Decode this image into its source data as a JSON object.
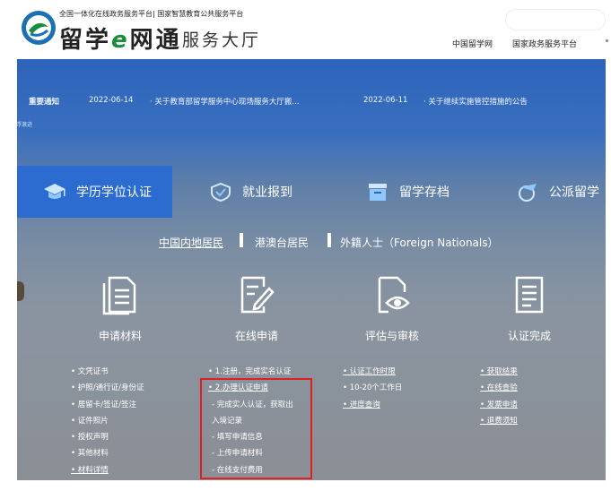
{
  "header": {
    "tagline": "全国一体化在线政务服务平台| 国家智慧教育公共服务平台",
    "logo_title_1": "留学",
    "logo_title_e": "e",
    "logo_title_2": "网通",
    "logo_subtitle": "服务大厅",
    "nav": [
      "中国留学网",
      "国家政务服务平台"
    ]
  },
  "notice": {
    "label": "重要通知",
    "items": [
      {
        "date": "2022-06-14",
        "text": "· 关于教育部留学服务中心现场服务大厅搬..."
      },
      {
        "date": "2022-06-11",
        "text": "· 关于继续实施管控措施的公告"
      }
    ],
    "small_left": "浮滚迹"
  },
  "tabs": [
    {
      "label": "学历学位认证",
      "icon": "graduation-cap-icon",
      "active": true
    },
    {
      "label": "就业报到",
      "icon": "badge-icon",
      "active": false
    },
    {
      "label": "留学存档",
      "icon": "archive-icon",
      "active": false
    },
    {
      "label": "公派留学",
      "icon": "plane-globe-icon",
      "active": false
    }
  ],
  "residents": [
    "中国内地居民",
    "港澳台居民",
    "外籍人士（Foreign Nationals）"
  ],
  "steps": [
    {
      "label": "申请材料",
      "icon": "documents-icon"
    },
    {
      "label": "在线申请",
      "icon": "edit-document-icon"
    },
    {
      "label": "评估与审核",
      "icon": "review-eye-icon"
    },
    {
      "label": "认证完成",
      "icon": "completed-list-icon"
    }
  ],
  "lists": {
    "materials": [
      "• 文凭证书",
      "• 护照/通行证/身份证",
      "• 居留卡/签证/签注",
      "• 证件照片",
      "• 授权声明",
      "• 其他材料",
      "• 材料详情"
    ],
    "online": [
      "• 1.注册，完成实名认证",
      "• 2.办理认证申请",
      "- 完成实人认证，获取出",
      "入境记录",
      "- 填写申请信息",
      "- 上传申请材料",
      "- 在线支付费用"
    ],
    "review": [
      "• 认证工作时限",
      "• 10-20个工作日",
      "• 进度查询"
    ],
    "complete": [
      "• 获取结果",
      "• 在线查验",
      "• 发票申请",
      "• 退费须知"
    ]
  },
  "colors": {
    "accent_blue": "#2c6bd0",
    "highlight_red": "#e02020",
    "brand_green": "#1a8c3c"
  }
}
